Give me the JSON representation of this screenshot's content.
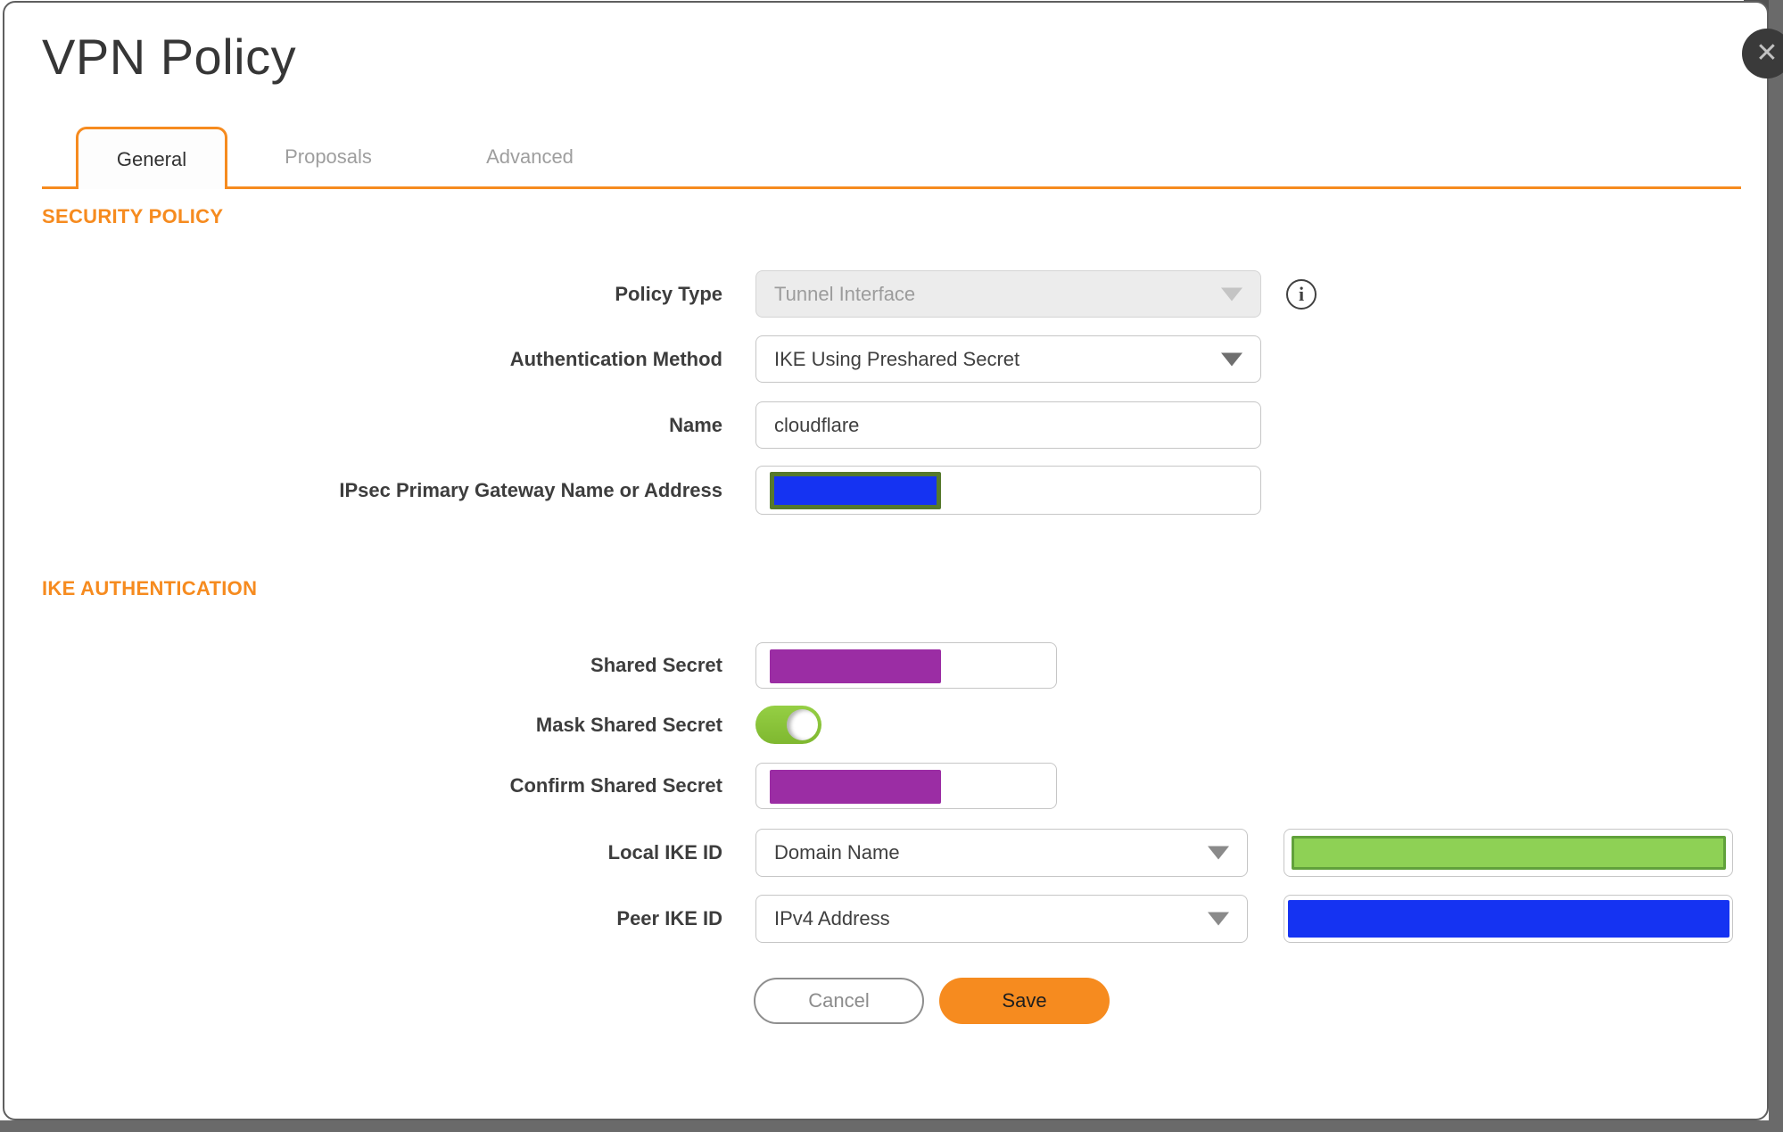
{
  "title": "VPN Policy",
  "close": {
    "icon": "✕"
  },
  "tabs": {
    "general": "General",
    "proposals": "Proposals",
    "advanced": "Advanced"
  },
  "security_policy": {
    "heading": "SECURITY POLICY",
    "policy_type": {
      "label": "Policy Type",
      "value": "Tunnel Interface",
      "disabled": true
    },
    "auth_method": {
      "label": "Authentication Method",
      "value": "IKE Using Preshared Secret"
    },
    "name": {
      "label": "Name",
      "value": "cloudflare"
    },
    "gateway": {
      "label": "IPsec Primary Gateway Name or Address",
      "value": "",
      "redacted": "blue"
    }
  },
  "ike_authentication": {
    "heading": "IKE AUTHENTICATION",
    "shared_secret": {
      "label": "Shared Secret",
      "value": "",
      "redacted": "purple"
    },
    "mask_shared_secret": {
      "label": "Mask Shared Secret",
      "state": "on"
    },
    "confirm_shared_secret": {
      "label": "Confirm Shared Secret",
      "value": "",
      "redacted": "purple"
    },
    "local_ike_id": {
      "label": "Local IKE ID",
      "value": "Domain Name",
      "redacted": "green"
    },
    "peer_ike_id": {
      "label": "Peer IKE ID",
      "value": "IPv4 Address",
      "redacted": "blue"
    }
  },
  "buttons": {
    "cancel": "Cancel",
    "save": "Save"
  },
  "colors": {
    "accent_orange": "#F68B1F",
    "redaction_blue": "#1533F2",
    "redaction_purple": "#9B2DA4",
    "redaction_green_fill": "#8ED155",
    "redaction_green_border": "#61A13B",
    "redaction_olive_border": "#56792C",
    "toggle_green": "#8CC63F"
  }
}
